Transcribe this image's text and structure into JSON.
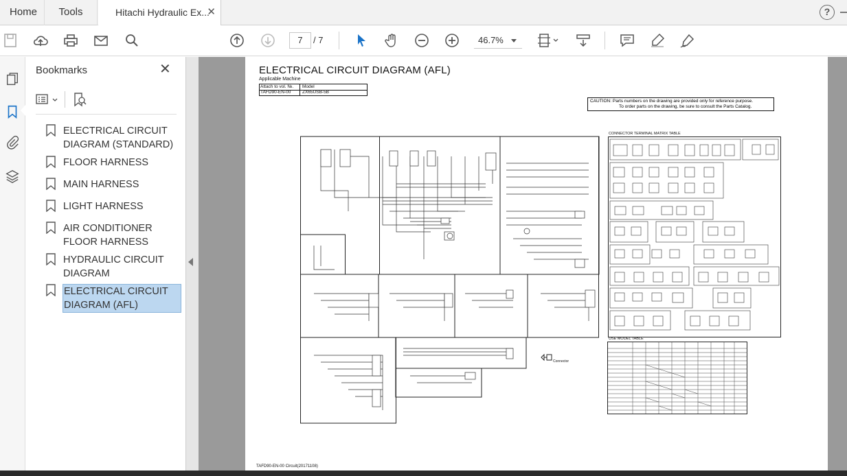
{
  "tabs": {
    "home": "Home",
    "tools": "Tools",
    "document": "Hitachi Hydraulic Ex...",
    "close_symbol": "✕"
  },
  "toolbar": {
    "current_page": "7",
    "page_separator": "/ 7",
    "zoom": "46.7%"
  },
  "bookmarks": {
    "title": "Bookmarks",
    "close_symbol": "✕",
    "items": [
      {
        "label": "ELECTRICAL CIRCUIT\nDIAGRAM (STANDARD)",
        "selected": false
      },
      {
        "label": "FLOOR HARNESS",
        "selected": false
      },
      {
        "label": "MAIN HARNESS",
        "selected": false
      },
      {
        "label": "LIGHT HARNESS",
        "selected": false
      },
      {
        "label": "AIR CONDITIONER\nFLOOR HARNESS",
        "selected": false
      },
      {
        "label": "HYDRAULIC CIRCUIT\nDIAGRAM",
        "selected": false
      },
      {
        "label": "ELECTRICAL CIRCUIT\nDIAGRAM (AFL)",
        "selected": true
      }
    ]
  },
  "page": {
    "title": "ELECTRICAL CIRCUIT DIAGRAM (AFL)",
    "applicable": "Applicable Machine",
    "table": {
      "col1_header": "Attach to vol. №.",
      "col2_header": "Model",
      "col1_value": "TAFD90-EN-00",
      "col2_value": "ZX65USB-5B"
    },
    "caution_line1": "CAUTION: Parts numbers on the drawing are provided only for reference purpose.",
    "caution_line2": "To order parts on the drawing, be sure to consult the Parts Catalog.",
    "connector_table_title": "CONNECTOR TERMINAL MATRIX TABLE",
    "use_model_title": "USE MODEL TABLE",
    "connector_label": "Connector",
    "footer": "TAFD90-EN-00  Circuit(20171108)"
  },
  "colors": {
    "selected_bg": "#bcd7f0",
    "viewer_bg": "#9a9a9a"
  }
}
